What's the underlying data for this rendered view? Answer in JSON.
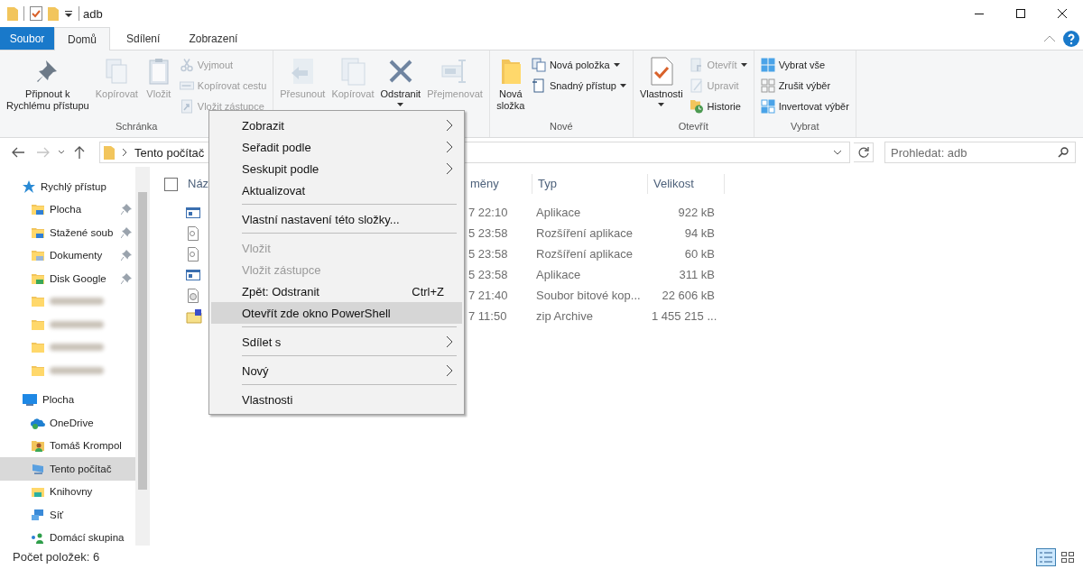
{
  "title_bar": {
    "title": "adb"
  },
  "ribbon_tabs": [
    {
      "label": "Soubor",
      "kind": "file",
      "selected": false
    },
    {
      "label": "Domů",
      "kind": "tab",
      "selected": true
    },
    {
      "label": "Sdílení",
      "kind": "tab",
      "selected": false
    },
    {
      "label": "Zobrazení",
      "kind": "tab",
      "selected": false
    }
  ],
  "ribbon": {
    "groups": [
      {
        "label": "Schránka",
        "items": [
          {
            "kind": "large",
            "label": "Připnout k\nRychlému přístupu",
            "disabled": false
          },
          {
            "kind": "large",
            "label": "Kopírovat",
            "disabled": true
          },
          {
            "kind": "large",
            "label": "Vložit",
            "disabled": true
          },
          {
            "kind": "stack",
            "items": [
              {
                "label": "Vyjmout",
                "disabled": true
              },
              {
                "label": "Kopírovat cestu",
                "disabled": true
              },
              {
                "label": "Vložit zástupce",
                "disabled": true
              }
            ]
          }
        ]
      },
      {
        "items": [
          {
            "kind": "large",
            "label": "Přesunout",
            "disabled": true
          },
          {
            "kind": "large",
            "label": "Kopírovat",
            "disabled": true
          },
          {
            "kind": "large",
            "label": "Odstranit",
            "disabled": false,
            "dropdown": true
          },
          {
            "kind": "large",
            "label": "Přejmenovat",
            "disabled": true
          }
        ]
      },
      {
        "label": "Nové",
        "items": [
          {
            "kind": "large",
            "label": "Nová\nsložka",
            "disabled": false
          },
          {
            "kind": "stack",
            "items": [
              {
                "label": "Nová položka",
                "disabled": false,
                "dropdown": true
              },
              {
                "label": "Snadný přístup",
                "disabled": false,
                "dropdown": true
              }
            ]
          }
        ]
      },
      {
        "label": "Otevřít",
        "items": [
          {
            "kind": "large",
            "label": "Vlastnosti",
            "disabled": false,
            "dropdown": true
          },
          {
            "kind": "stack",
            "items": [
              {
                "label": "Otevřít",
                "disabled": true,
                "dropdown": true
              },
              {
                "label": "Upravit",
                "disabled": true
              },
              {
                "label": "Historie",
                "disabled": false
              }
            ]
          }
        ]
      },
      {
        "label": "Vybrat",
        "items": [
          {
            "kind": "stack",
            "items": [
              {
                "label": "Vybrat vše",
                "disabled": false
              },
              {
                "label": "Zrušit výběr",
                "disabled": false
              },
              {
                "label": "Invertovat výběr",
                "disabled": false
              }
            ]
          }
        ]
      }
    ]
  },
  "address_bar": {
    "segments": [
      "Tento počítač"
    ]
  },
  "search": {
    "placeholder": "Prohledat: adb"
  },
  "nav": {
    "items": [
      {
        "label": "Rychlý přístup",
        "selected": false,
        "children": [
          {
            "label": "Plocha",
            "selected": false,
            "pinned": true,
            "blurred": false
          },
          {
            "label": "Stažené soub",
            "selected": false,
            "pinned": true,
            "blurred": false
          },
          {
            "label": "Dokumenty",
            "selected": false,
            "pinned": true,
            "blurred": false
          },
          {
            "label": "Disk Google",
            "selected": false,
            "pinned": true,
            "blurred": false
          },
          {
            "selected": false,
            "pinned": false,
            "blurred": true
          },
          {
            "selected": false,
            "pinned": false,
            "blurred": true
          },
          {
            "selected": false,
            "pinned": false,
            "blurred": true
          },
          {
            "selected": false,
            "pinned": false,
            "blurred": true
          }
        ]
      },
      {
        "label": "Plocha",
        "selected": false,
        "children": [
          {
            "label": "OneDrive",
            "selected": false,
            "pinned": false,
            "blurred": false
          },
          {
            "label": "Tomáš Krompol",
            "selected": false,
            "pinned": false,
            "blurred": false
          },
          {
            "label": "Tento počítač",
            "selected": true,
            "pinned": false,
            "blurred": false
          },
          {
            "label": "Knihovny",
            "selected": false,
            "pinned": false,
            "blurred": false
          },
          {
            "label": "Síť",
            "selected": false,
            "pinned": false,
            "blurred": false
          },
          {
            "label": "Domácí skupina",
            "selected": false,
            "pinned": false,
            "blurred": false
          }
        ]
      }
    ]
  },
  "file_list": {
    "select_all": {
      "checked": false
    },
    "columns": [
      "Náz",
      "měny",
      "Typ",
      "Velikost"
    ],
    "rows": [
      {
        "kind": "exe",
        "modified": "7 22:10",
        "type": "Aplikace",
        "size": "922 kB"
      },
      {
        "kind": "dll",
        "modified": "5 23:58",
        "type": "Rozšíření aplikace",
        "size": "94 kB"
      },
      {
        "kind": "dll",
        "modified": "5 23:58",
        "type": "Rozšíření aplikace",
        "size": "60 kB"
      },
      {
        "kind": "exe",
        "modified": "5 23:58",
        "type": "Aplikace",
        "size": "311 kB"
      },
      {
        "kind": "img",
        "modified": "7 21:40",
        "type": "Soubor bitové kop...",
        "size": "22 606 kB"
      },
      {
        "kind": "zip",
        "modified": "7 11:50",
        "type": "zip Archive",
        "size": "1 455 215 ..."
      }
    ]
  },
  "context_menu": {
    "items": [
      {
        "kind": "item",
        "label": "Zobrazit",
        "submenu": true,
        "disabled": false,
        "highlighted": false
      },
      {
        "kind": "item",
        "label": "Seřadit podle",
        "submenu": true,
        "disabled": false,
        "highlighted": false
      },
      {
        "kind": "item",
        "label": "Seskupit podle",
        "submenu": true,
        "disabled": false,
        "highlighted": false
      },
      {
        "kind": "item",
        "label": "Aktualizovat",
        "submenu": false,
        "disabled": false,
        "highlighted": false
      },
      {
        "kind": "separator"
      },
      {
        "kind": "item",
        "label": "Vlastní nastavení této složky...",
        "submenu": false,
        "disabled": false,
        "highlighted": false
      },
      {
        "kind": "separator"
      },
      {
        "kind": "item",
        "label": "Vložit",
        "submenu": false,
        "disabled": true,
        "highlighted": false
      },
      {
        "kind": "item",
        "label": "Vložit zástupce",
        "submenu": false,
        "disabled": true,
        "highlighted": false
      },
      {
        "kind": "item",
        "label": "Zpět: Odstranit",
        "shortcut": "Ctrl+Z",
        "submenu": false,
        "disabled": false,
        "highlighted": false
      },
      {
        "kind": "item",
        "label": "Otevřít zde okno PowerShell",
        "submenu": false,
        "disabled": false,
        "highlighted": true
      },
      {
        "kind": "separator"
      },
      {
        "kind": "item",
        "label": "Sdílet s",
        "submenu": true,
        "disabled": false,
        "highlighted": false
      },
      {
        "kind": "separator"
      },
      {
        "kind": "item",
        "label": "Nový",
        "submenu": true,
        "disabled": false,
        "highlighted": false
      },
      {
        "kind": "separator"
      },
      {
        "kind": "item",
        "label": "Vlastnosti",
        "submenu": false,
        "disabled": false,
        "highlighted": false
      }
    ]
  },
  "status_bar": {
    "text": "Počet položek: 6",
    "view_buttons": [
      {
        "selected": true
      },
      {
        "selected": false
      }
    ]
  }
}
